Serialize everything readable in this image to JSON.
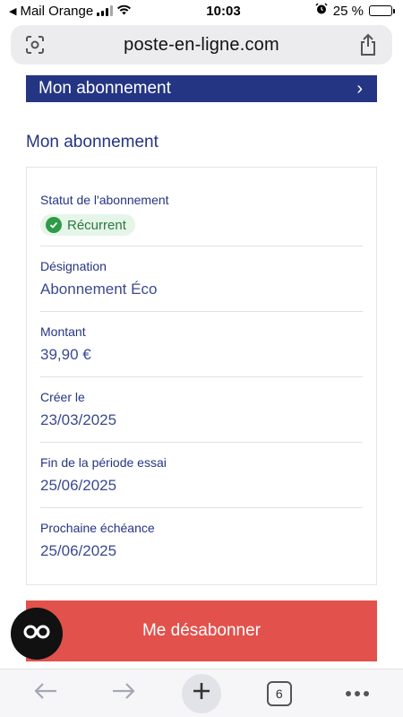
{
  "status_bar": {
    "back_label": "◀",
    "carrier": "Mail Orange",
    "time": "10:03",
    "battery": "25 %",
    "battery_level": 0.25
  },
  "browser": {
    "url": "poste-en-ligne.com"
  },
  "nav_banner": {
    "label": "Mon abonnement",
    "chevron": "›"
  },
  "section": {
    "title": "Mon abonnement"
  },
  "subscription": {
    "status_label": "Statut de l'abonnement",
    "status_value": "Récurrent",
    "fields": [
      {
        "label": "Désignation",
        "value": "Abonnement Éco"
      },
      {
        "label": "Montant",
        "value": "39,90 €"
      },
      {
        "label": "Créer le",
        "value": "23/03/2025"
      },
      {
        "label": "Fin de la période essai",
        "value": "25/06/2025"
      },
      {
        "label": "Prochaine échéance",
        "value": "25/06/2025"
      }
    ]
  },
  "actions": {
    "unsubscribe_label": "Me désabonner"
  },
  "toolbar": {
    "tab_count": "6"
  },
  "icons": {
    "url_left": "screen-capture-icon",
    "url_right": "share-icon",
    "floating": "infinity-icon",
    "back": "arrow-left-icon",
    "forward": "arrow-right-icon",
    "add": "plus-icon",
    "tabs": "tabs-icon",
    "more": "more-icon"
  },
  "colors": {
    "banner": "#243583",
    "unsubscribe": "#e2514c",
    "badge_bg": "#e6f5ea",
    "badge_icon": "#2e9b47"
  }
}
